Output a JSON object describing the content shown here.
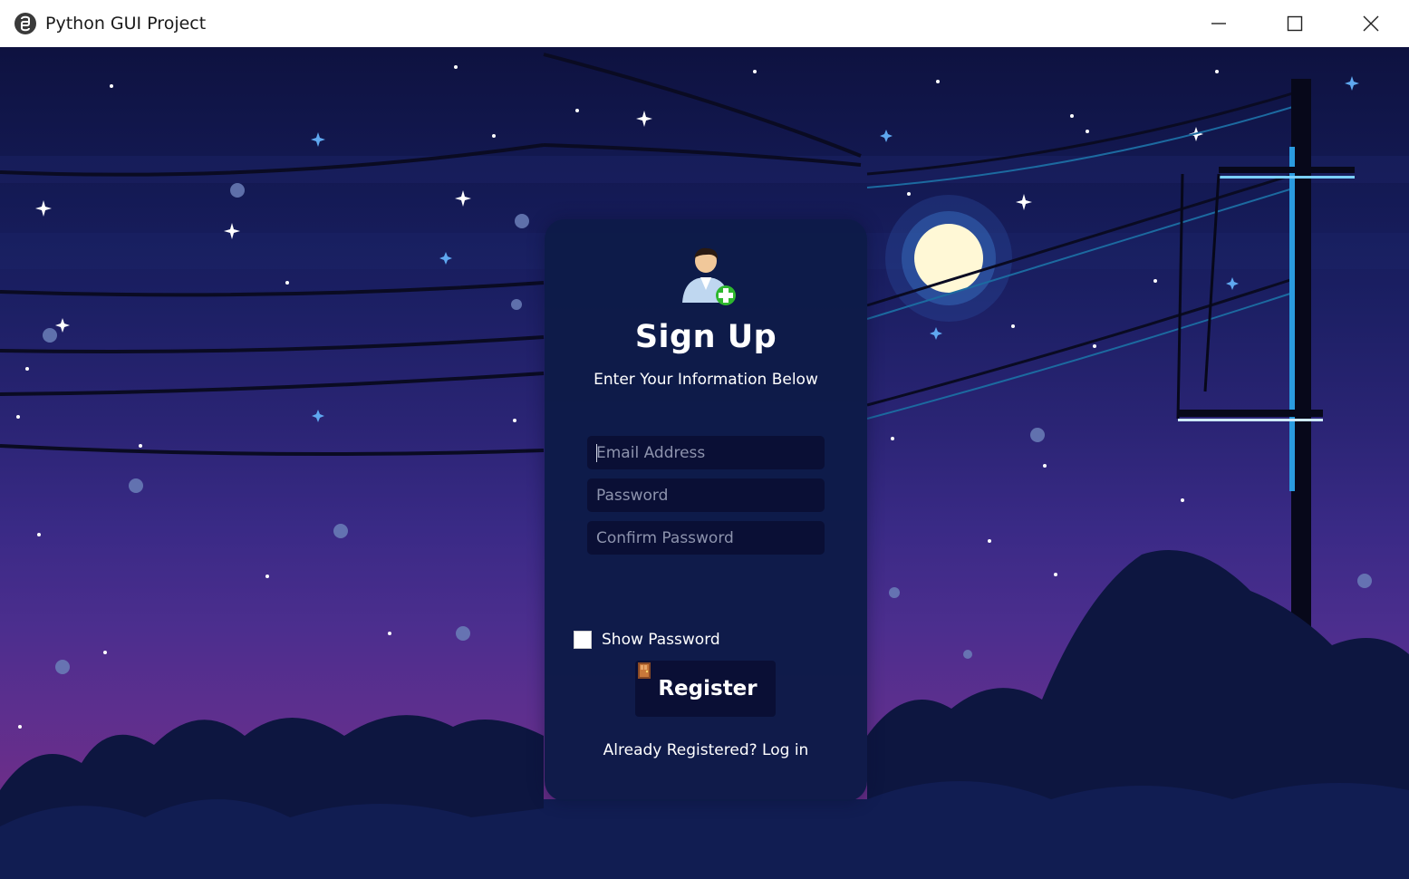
{
  "window": {
    "title": "Python GUI Project",
    "controls": [
      "minimize",
      "maximize",
      "close"
    ]
  },
  "form": {
    "title": "Sign Up",
    "subtitle": "Enter Your Information Below",
    "fields": {
      "email_placeholder": "Email Address",
      "password_placeholder": "Password",
      "confirm_placeholder": "Confirm Password"
    },
    "show_password_label": "Show Password",
    "register_label": "Register",
    "login_link": "Already Registered? Log in"
  },
  "colors": {
    "card_bg": "#0d1b48",
    "field_bg": "#0a0f35",
    "sky_top": "#0e1240",
    "sky_bottom": "#6a2e8a",
    "moon": "#fff8d6",
    "text": "#ffffff"
  },
  "icons": {
    "app": "python-logo-icon",
    "user": "add-user-icon",
    "register": "door-icon"
  }
}
